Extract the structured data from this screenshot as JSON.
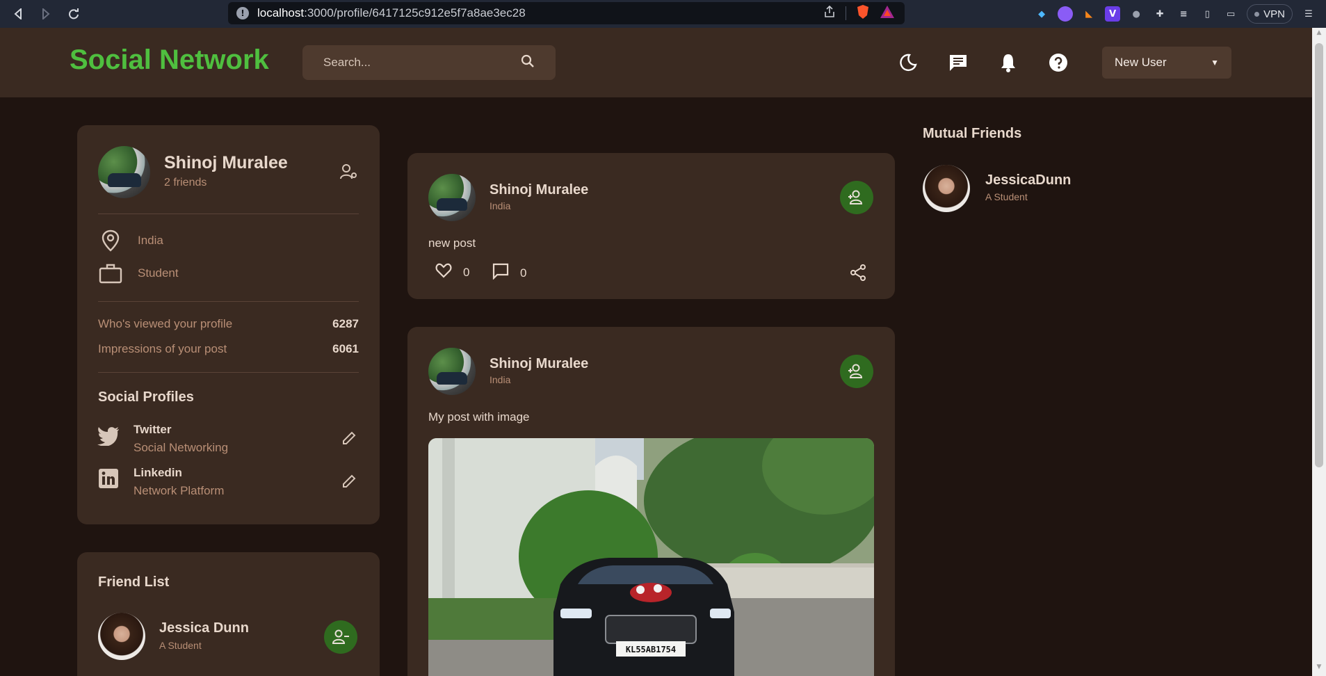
{
  "browser": {
    "url_host": "localhost",
    "url_path": ":3000/profile/6417125c912e5f7a8ae3ec28",
    "vpn_label": "VPN"
  },
  "header": {
    "brand": "Social Network",
    "search_placeholder": "Search...",
    "user_select": "New User"
  },
  "profile": {
    "name": "Shinoj Muralee",
    "friends": "2 friends",
    "location": "India",
    "occupation": "Student",
    "stats": [
      {
        "label": "Who's viewed your profile",
        "value": "6287"
      },
      {
        "label": "Impressions of your post",
        "value": "6061"
      }
    ],
    "social_title": "Social Profiles",
    "social": [
      {
        "name": "Twitter",
        "sub": "Social Networking"
      },
      {
        "name": "Linkedin",
        "sub": "Network Platform"
      }
    ]
  },
  "friend_list": {
    "title": "Friend List",
    "friends": [
      {
        "name": "Jessica Dunn",
        "sub": "A Student"
      }
    ]
  },
  "posts": [
    {
      "name": "Shinoj Muralee",
      "location": "India",
      "text": "new post",
      "likes": "0",
      "comments": "0"
    },
    {
      "name": "Shinoj Muralee",
      "location": "India",
      "text": "My post with image",
      "plate": "KL55AB1754"
    }
  ],
  "mutual": {
    "title": "Mutual Friends",
    "friends": [
      {
        "name": "JessicaDunn",
        "sub": "A Student"
      }
    ]
  },
  "colors": {
    "brand": "#4fbf3f",
    "background": "#1f1410",
    "card": "#3a2a21",
    "accent_button": "#2f6b1f"
  }
}
